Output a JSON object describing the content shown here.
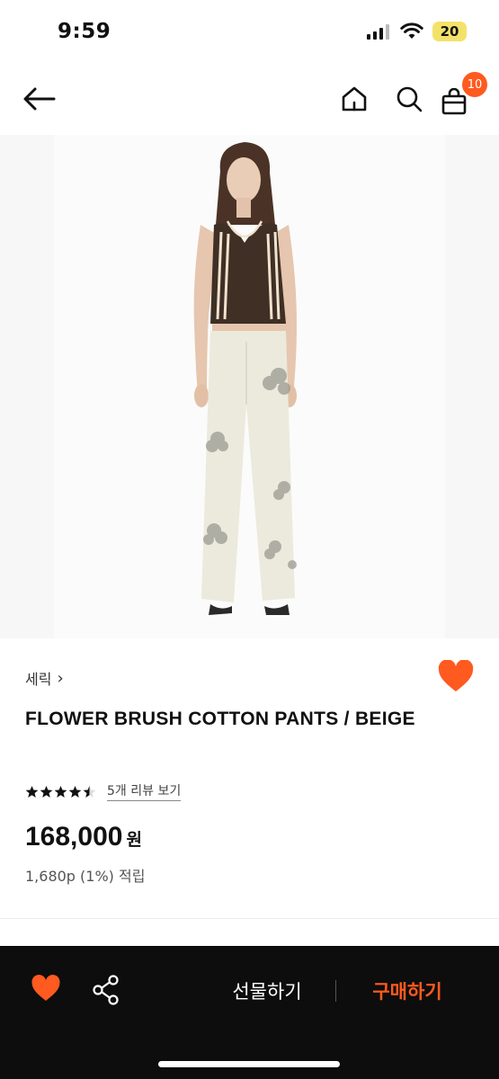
{
  "status": {
    "time": "9:59",
    "battery": "20"
  },
  "nav": {
    "back_icon": "arrow-left-icon",
    "home_icon": "home-icon",
    "search_icon": "search-icon",
    "cart_icon": "bag-icon",
    "cart_count": "10"
  },
  "product": {
    "brand": "세릭",
    "brand_chevron": "›",
    "title": "FLOWER BRUSH COTTON PANTS / BEIGE",
    "rating_stars": 4.5,
    "review_link": "5개 리뷰 보기",
    "price": "168,000",
    "currency": "원",
    "points": "1,680p (1%) 적립"
  },
  "bottom_bar": {
    "wish_icon": "heart-icon",
    "share_icon": "share-icon",
    "gift_label": "선물하기",
    "buy_label": "구매하기"
  },
  "colors": {
    "accent": "#ff5a1f",
    "bottom_bar_bg": "#0d0d0d",
    "badge": "#ff5a1f"
  }
}
